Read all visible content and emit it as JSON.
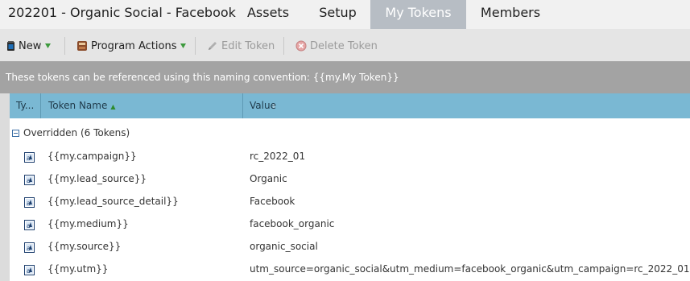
{
  "header": {
    "program_title": "202201 - Organic Social - Facebook",
    "tabs": [
      {
        "label": "Assets",
        "active": false
      },
      {
        "label": "Setup",
        "active": false
      },
      {
        "label": "My Tokens",
        "active": true
      },
      {
        "label": "Members",
        "active": false
      }
    ]
  },
  "toolbar": {
    "new_label": "New",
    "program_actions_label": "Program Actions",
    "edit_token_label": "Edit Token",
    "delete_token_label": "Delete Token"
  },
  "info": {
    "text": "These tokens can be referenced using this naming convention: {{my.My Token}}"
  },
  "grid": {
    "columns": [
      "Ty...",
      "Token Name",
      "Value"
    ],
    "group_label": "Overridden (6 Tokens)",
    "rows": [
      {
        "type_icon": "text-token-icon",
        "name": "{{my.campaign}}",
        "value": "rc_2022_01"
      },
      {
        "type_icon": "text-token-icon",
        "name": "{{my.lead_source}}",
        "value": "Organic"
      },
      {
        "type_icon": "text-token-icon",
        "name": "{{my.lead_source_detail}}",
        "value": "Facebook"
      },
      {
        "type_icon": "text-token-icon",
        "name": "{{my.medium}}",
        "value": "facebook_organic"
      },
      {
        "type_icon": "text-token-icon",
        "name": "{{my.source}}",
        "value": "organic_social"
      },
      {
        "type_icon": "text-token-icon",
        "name": "{{my.utm}}",
        "value": "utm_source=organic_social&utm_medium=facebook_organic&utm_campaign=rc_2022_01"
      }
    ]
  },
  "colors": {
    "active_tab": "#b7bdc4",
    "grid_header": "#7ab8d3",
    "info_bar": "#a3a3a3",
    "toolbar": "#e5e5e5"
  }
}
